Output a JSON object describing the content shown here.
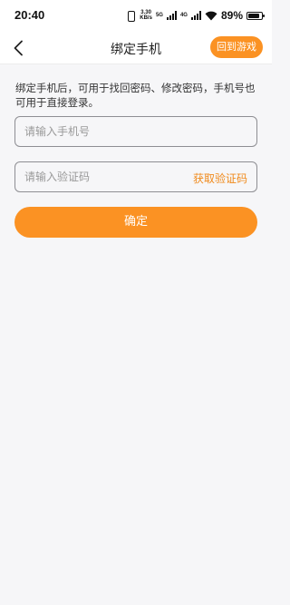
{
  "status_bar": {
    "time": "20:40",
    "speed_value": "3.30",
    "speed_unit": "KB/s",
    "network_tag_a": "5G",
    "network_tag_b": "4G",
    "battery_percent": "89%",
    "battery_level": 0.89
  },
  "header": {
    "title": "绑定手机",
    "back_icon": "chevron-left-icon",
    "return_label": "回到游戏"
  },
  "form": {
    "hint": "绑定手机后，可用于找回密码、修改密码，手机号也可用于直接登录。",
    "phone_placeholder": "请输入手机号",
    "code_placeholder": "请输入验证码",
    "get_code_label": "获取验证码",
    "confirm_label": "确定"
  },
  "colors": {
    "accent": "#fb9223",
    "accent_text": "#f08a1c",
    "background": "#f6f6f8"
  }
}
